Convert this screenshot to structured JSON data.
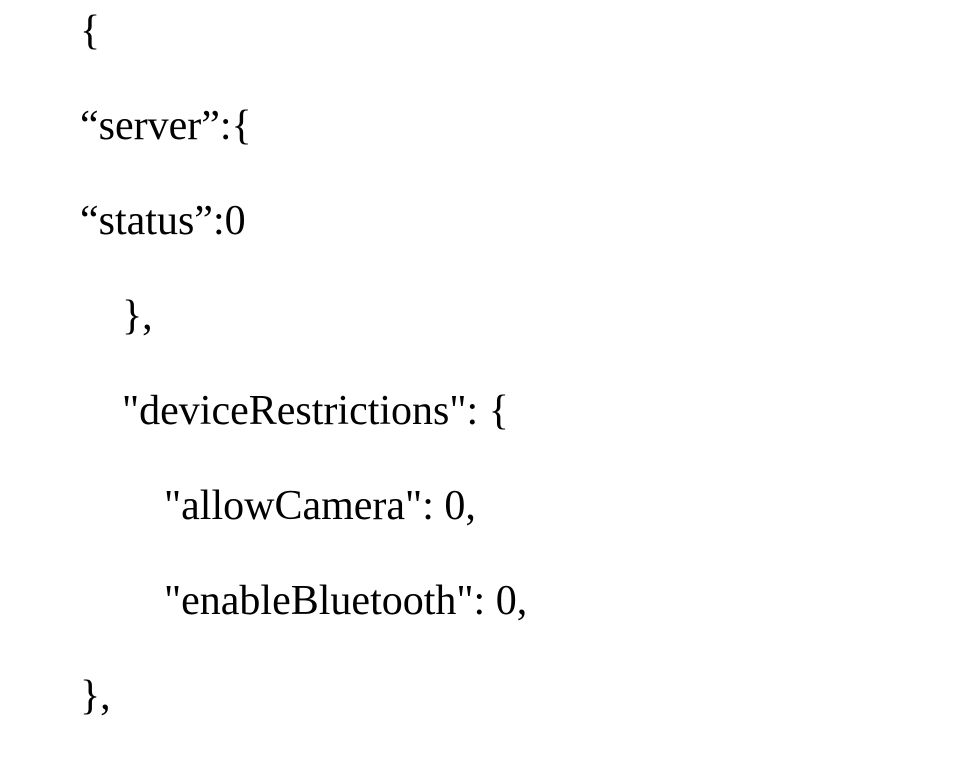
{
  "code": {
    "line1": "{",
    "line2": "“server”:{",
    "line3": "“status”:0",
    "line4": "    },",
    "line5": "    \"deviceRestrictions\": {",
    "line6": "        \"allowCamera\": 0,",
    "line7": "        \"enableBluetooth\": 0,",
    "line8": "},"
  }
}
